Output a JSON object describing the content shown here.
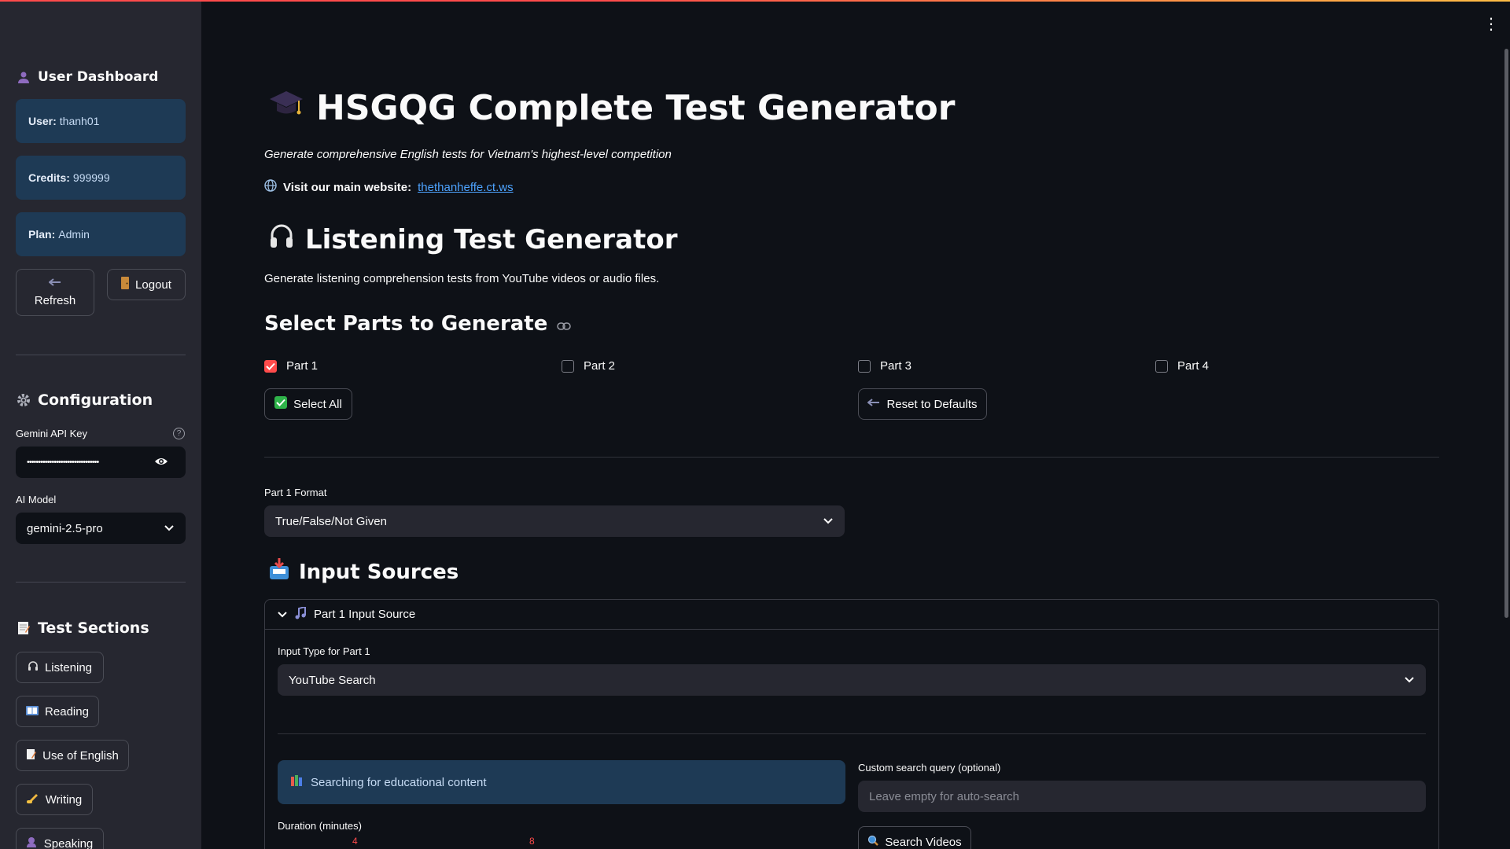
{
  "sidebar": {
    "user_dashboard": "User Dashboard",
    "user_label": "User:",
    "user_value": "thanh01",
    "credits_label": "Credits:",
    "credits_value": "999999",
    "plan_label": "Plan:",
    "plan_value": "Admin",
    "refresh_label": "Refresh",
    "logout_label": "Logout",
    "configuration": "Configuration",
    "api_key_label": "Gemini API Key",
    "api_key_value": "••••••••••••••••••••••••••••••••",
    "model_label": "AI Model",
    "model_value": "gemini-2.5-pro",
    "test_sections": "Test Sections",
    "sections": [
      "Listening",
      "Reading",
      "Use of English",
      "Writing",
      "Speaking"
    ]
  },
  "main": {
    "title": "HSGQG Complete Test Generator",
    "subtitle": "Generate comprehensive English tests for Vietnam's highest-level competition",
    "visit_label": "Visit our main website:",
    "visit_link": "thethanheffe.ct.ws",
    "listening_title": "Listening Test Generator",
    "listening_desc": "Generate listening comprehension tests from YouTube videos or audio files.",
    "select_parts_title": "Select Parts to Generate",
    "parts": [
      {
        "label": "Part 1",
        "checked": true
      },
      {
        "label": "Part 2",
        "checked": false
      },
      {
        "label": "Part 3",
        "checked": false
      },
      {
        "label": "Part 4",
        "checked": false
      }
    ],
    "select_all_label": "Select All",
    "reset_label": "Reset to Defaults",
    "part1_format_label": "Part 1 Format",
    "part1_format_value": "True/False/Not Given",
    "input_sources_title": "Input Sources",
    "expander_title": "Part 1 Input Source",
    "input_type_label": "Input Type for Part 1",
    "input_type_value": "YouTube Search",
    "searching_text": "Searching for educational content",
    "custom_query_label": "Custom search query (optional)",
    "custom_query_placeholder": "Leave empty for auto-search",
    "duration_label": "Duration (minutes)",
    "duration_min": "4",
    "duration_max": "8",
    "search_videos_label": "Search Videos"
  },
  "colors": {
    "background": "#0e1117",
    "sidebar": "#262730",
    "accent": "#ff4b4b",
    "info": "#1e3a55",
    "link": "#4da3ff"
  }
}
